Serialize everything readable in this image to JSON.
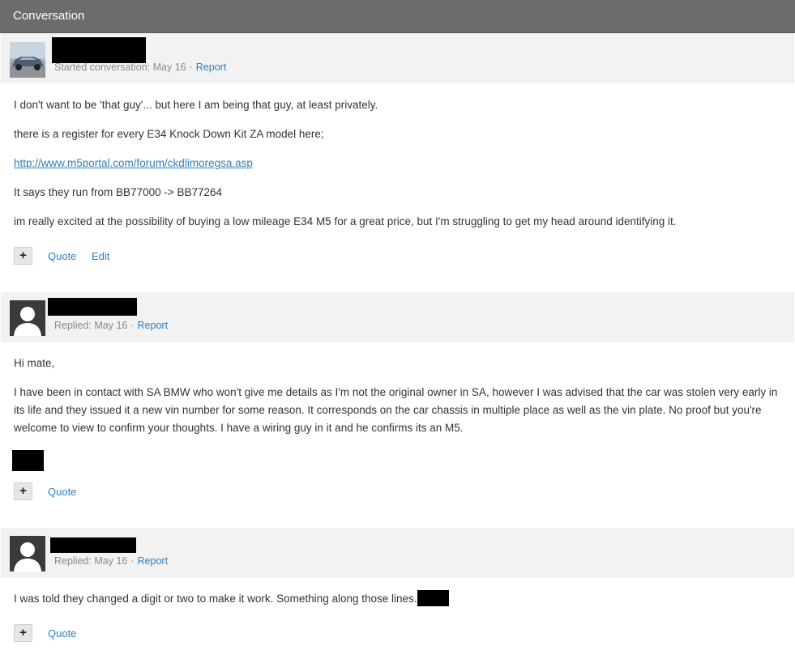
{
  "window": {
    "title": "Conversation"
  },
  "posts": [
    {
      "meta_label": "Started conversation:",
      "date": "May 16",
      "sep": "·",
      "report": "Report",
      "paragraphs": [
        "I don't want to be 'that guy'... but here I am being that guy, at least privately.",
        "there is a register for every E34 Knock Down Kit ZA model here;",
        "http://www.m5portal.com/forum/ckdlimoregsa.asp",
        "It says they run from BB77000 -> BB77264",
        "im really excited at the possibility of buying a low mileage E34 M5 for a great price, but I'm struggling to get my head around identifying it."
      ],
      "actions": {
        "plus": "+",
        "quote": "Quote",
        "edit": "Edit"
      }
    },
    {
      "meta_label": "Replied:",
      "date": "May 16",
      "sep": "·",
      "report": "Report",
      "paragraphs": [
        "Hi mate,",
        "I have been in contact with SA BMW who won't give me details as I'm not the original owner in SA, however I was advised that the car was stolen very early in its life and they issued it a new vin number for some reason. It corresponds on the car chassis in multiple place as well as the vin plate. No proof but you're welcome to view to confirm your thoughts. I have a wiring guy in it and he confirms its an M5."
      ],
      "actions": {
        "plus": "+",
        "quote": "Quote"
      }
    },
    {
      "meta_label": "Replied:",
      "date": "May 16",
      "sep": "·",
      "report": "Report",
      "paragraphs": [
        "I was told they changed a digit or two to make it work. Something along those lines."
      ],
      "actions": {
        "plus": "+",
        "quote": "Quote"
      }
    }
  ],
  "colors": {
    "header_bg": "#6c6c6c",
    "post_header_bg": "#f2f2f2",
    "link": "#2f7fbf",
    "meta_text": "#8a8a8a",
    "redaction": "#000000"
  },
  "icons": {
    "avatar_post1": "car-photo-avatar",
    "avatar_default": "default-user-avatar",
    "plus": "plus-icon"
  }
}
